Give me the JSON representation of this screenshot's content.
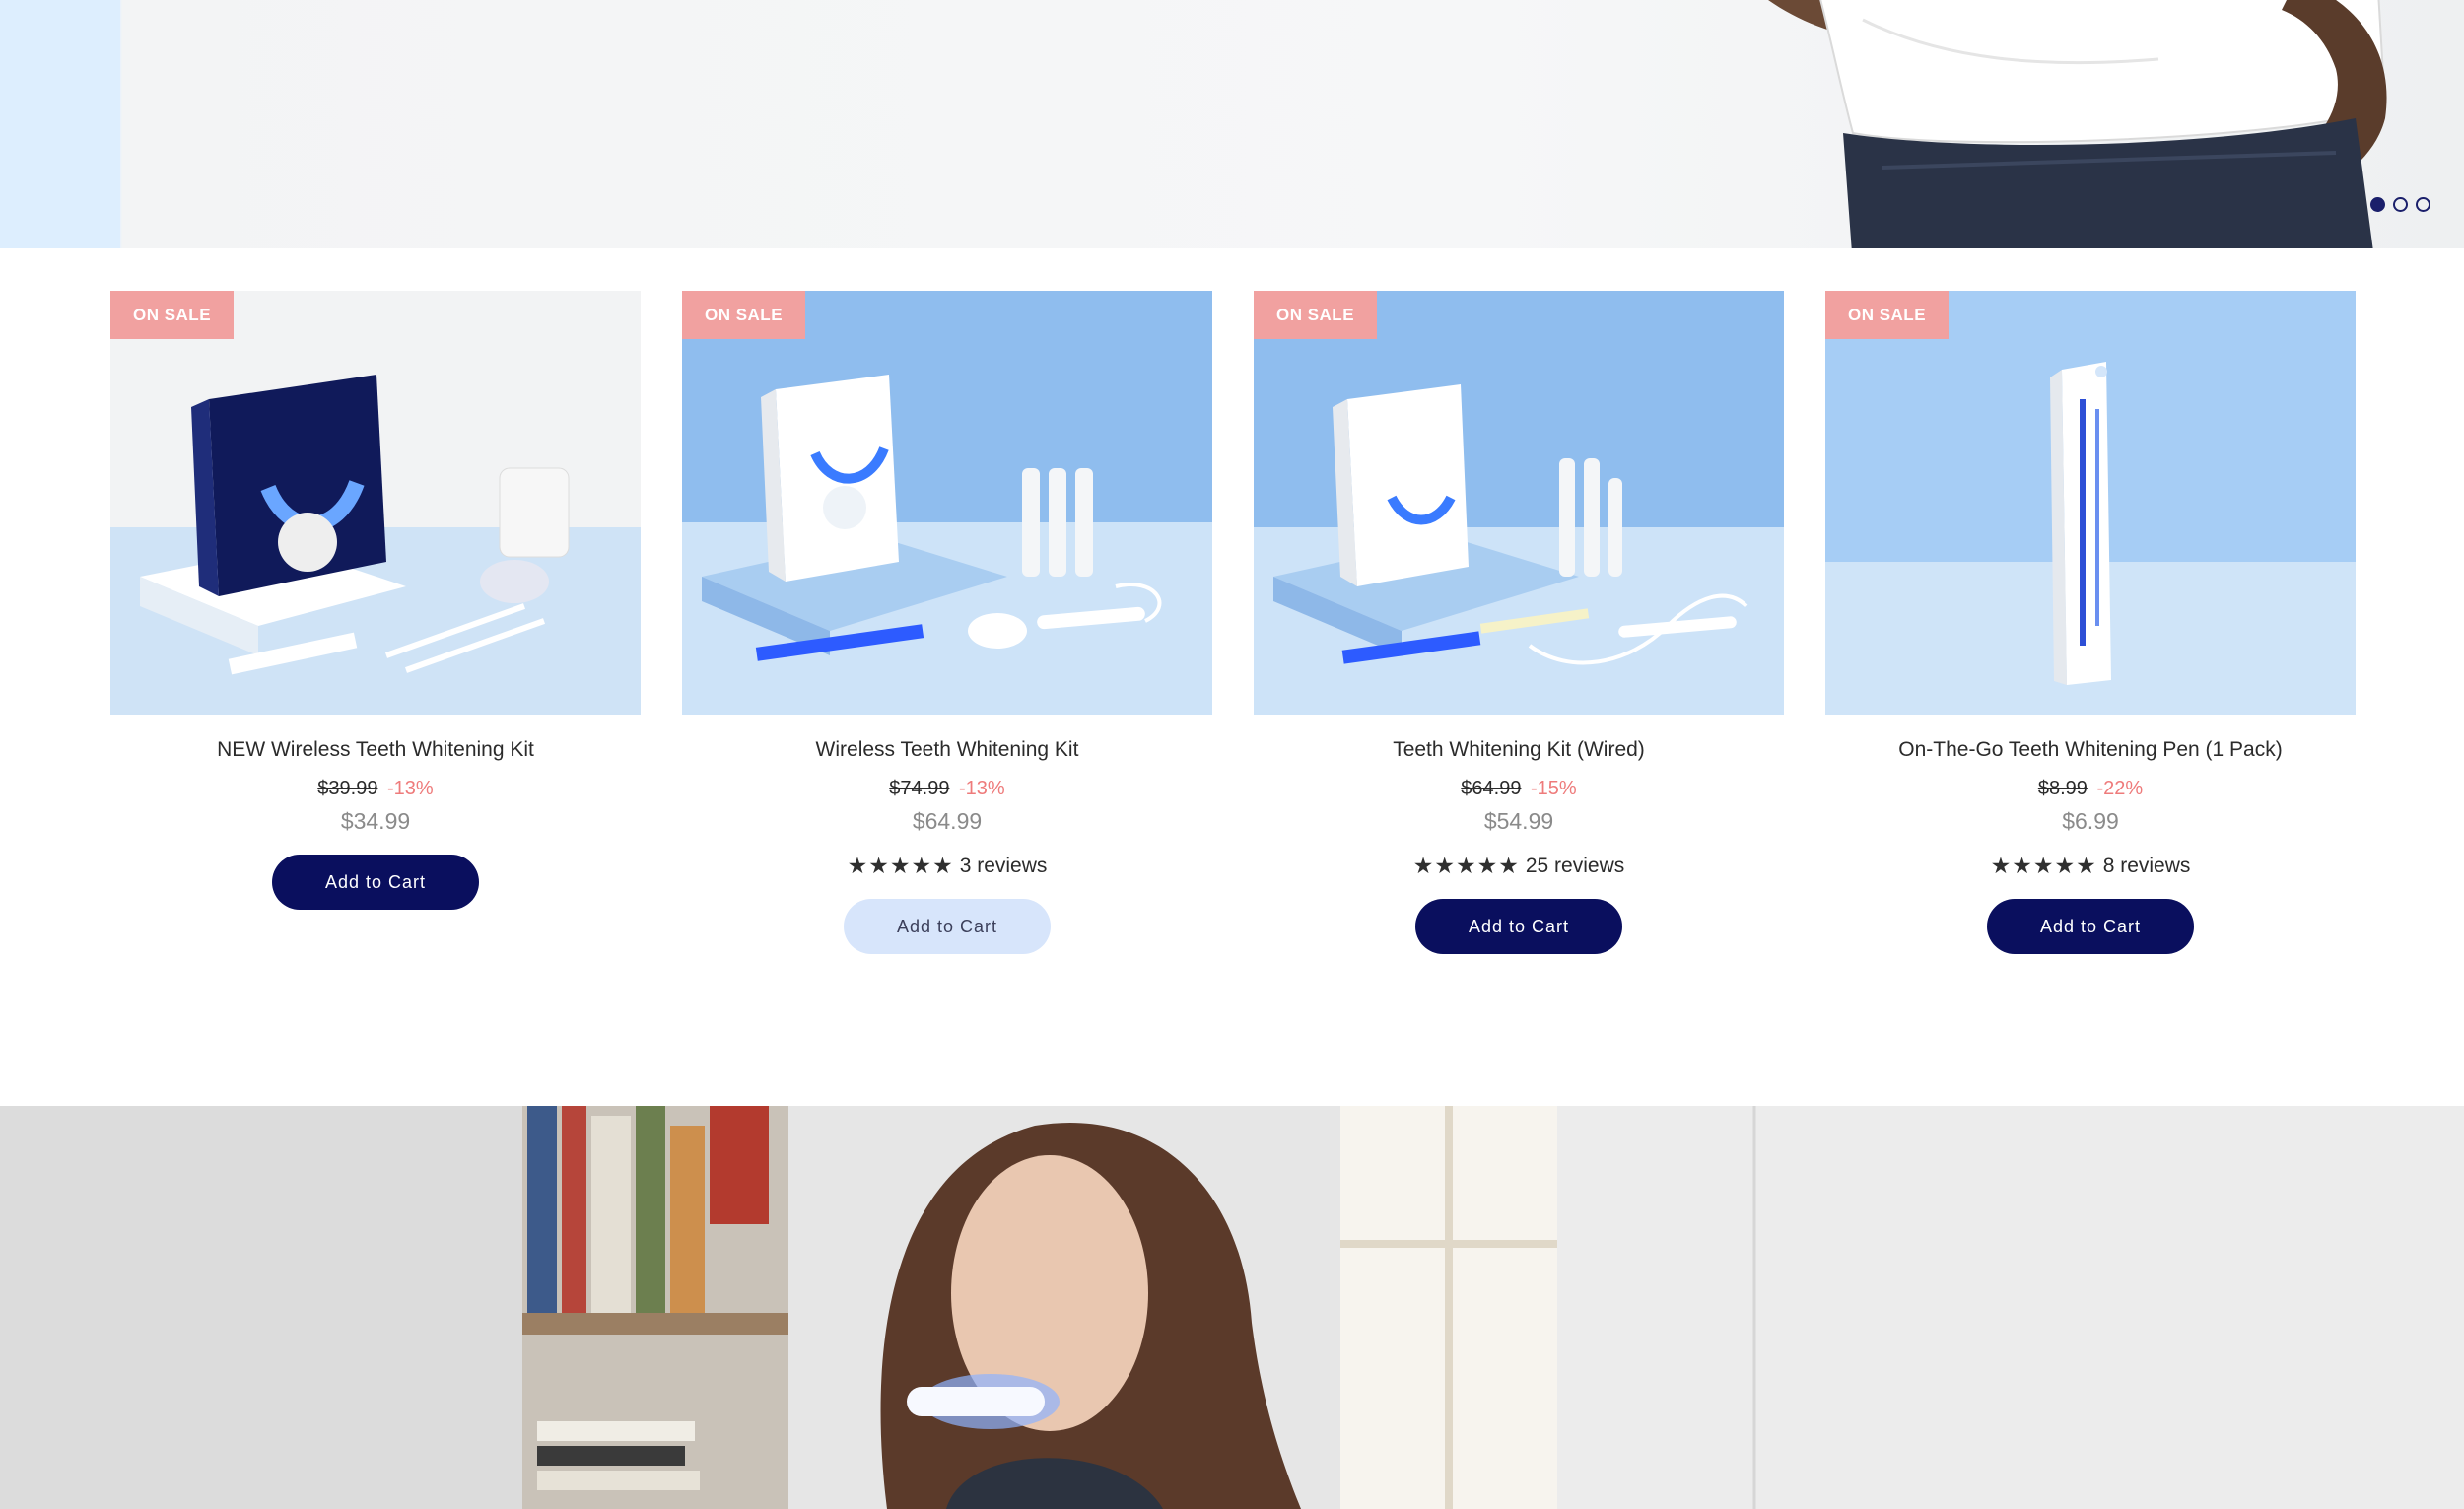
{
  "hero": {
    "slide_dots": [
      true,
      false,
      false
    ]
  },
  "products": [
    {
      "badge": "ON SALE",
      "title": "NEW Wireless Teeth Whitening Kit",
      "old_price": "$39.99",
      "discount": "-13%",
      "price": "$34.99",
      "rating": "",
      "reviews": "",
      "button": "Add to Cart",
      "button_style": "dark"
    },
    {
      "badge": "ON SALE",
      "title": "Wireless Teeth Whitening Kit",
      "old_price": "$74.99",
      "discount": "-13%",
      "price": "$64.99",
      "rating": 5,
      "reviews": "3 reviews",
      "button": "Add to Cart",
      "button_style": "light"
    },
    {
      "badge": "ON SALE",
      "title": "Teeth Whitening Kit (Wired)",
      "old_price": "$64.99",
      "discount": "-15%",
      "price": "$54.99",
      "rating": 5,
      "reviews": "25 reviews",
      "button": "Add to Cart",
      "button_style": "dark"
    },
    {
      "badge": "ON SALE",
      "title": "On-The-Go Teeth Whitening Pen (1 Pack)",
      "old_price": "$8.99",
      "discount": "-22%",
      "price": "$6.99",
      "rating": 5,
      "reviews": "8 reviews",
      "button": "Add to Cart",
      "button_style": "dark"
    }
  ],
  "colors": {
    "badge": "#f1a1a0",
    "discount": "#ee7b7b",
    "button_dark": "#0a0f5e",
    "button_light": "#d7e5fb"
  },
  "icons": {
    "rating": "star-icon",
    "hero_image": "person-white-shirt-image",
    "bottom_image": "woman-using-led-whitening-device-image"
  }
}
